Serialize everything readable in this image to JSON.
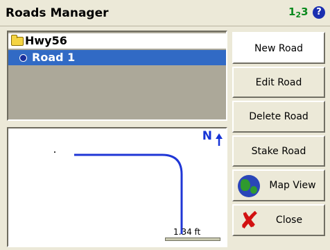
{
  "window": {
    "title": "Roads Manager",
    "units_icon_main": "1",
    "units_icon_sub": "2",
    "units_icon_tail": "3",
    "help_icon": "?"
  },
  "tree": {
    "items": [
      {
        "label": "Hwy56",
        "icon": "folder-icon"
      },
      {
        "label": "Road 1",
        "icon": "road-dot-icon",
        "selected": true
      }
    ]
  },
  "map": {
    "north_label": "N",
    "scale_label": "1.34 ft"
  },
  "buttons": {
    "new_road": "New Road",
    "edit_road": "Edit Road",
    "delete_road": "Delete Road",
    "stake_road": "Stake Road",
    "map_view": "Map View",
    "close": "Close"
  },
  "colors": {
    "selection": "#316ac5",
    "road_line": "#1f36d6",
    "north_arrow": "#1634d6",
    "units_icon": "#0b8a1e"
  }
}
